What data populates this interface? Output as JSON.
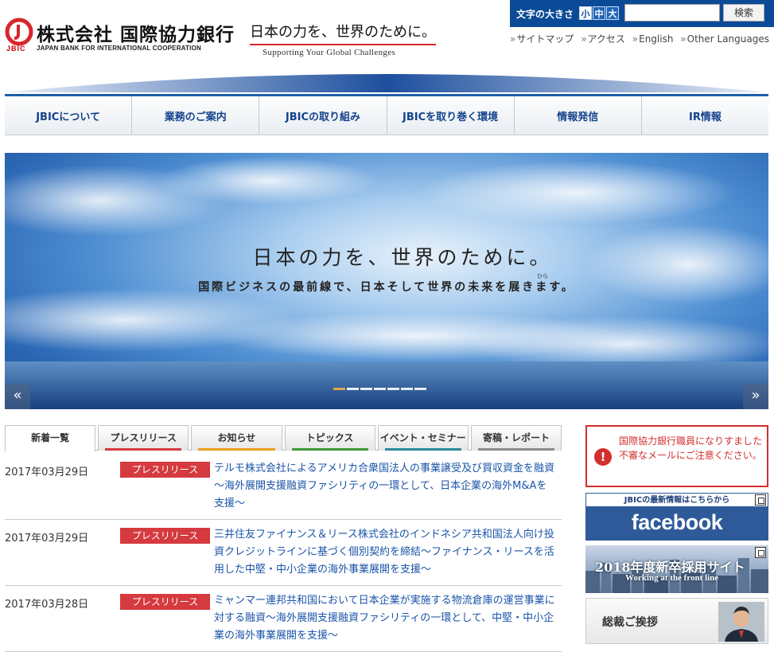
{
  "header": {
    "logo_jbic": "JBIC",
    "logo_name_ja": "株式会社 国際協力銀行",
    "logo_name_en": "JAPAN BANK FOR INTERNATIONAL COOPERATION",
    "tagline_ja": "日本の力を、世界のために。",
    "tagline_en": "Supporting Your Global Challenges",
    "fontsize_label": "文字の大きさ",
    "fontsize_small": "小",
    "fontsize_mid": "中",
    "fontsize_large": "大",
    "search_value": "",
    "search_button": "検索",
    "links": [
      "サイトマップ",
      "アクセス",
      "English",
      "Other Languages"
    ]
  },
  "nav": [
    "JBICについて",
    "業務のご案内",
    "JBICの取り組み",
    "JBICを取り巻く環境",
    "情報発信",
    "IR情報"
  ],
  "hero": {
    "title": "日本の力を、世界のために。",
    "subtitle": "国際ビジネスの最前線で、日本そして世界の未来を展きます。",
    "ruby": "ひら",
    "prev": "«",
    "next": "»",
    "slide_count": 7,
    "active_slide": 0
  },
  "tabs": [
    {
      "label": "新着一覧",
      "active": true,
      "bar": "#ffffff"
    },
    {
      "label": "プレスリリース",
      "active": false,
      "bar": "#d53a3f"
    },
    {
      "label": "お知らせ",
      "active": false,
      "bar": "#e6a11f"
    },
    {
      "label": "トピックス",
      "active": false,
      "bar": "#3f9a3a"
    },
    {
      "label": "イベント・セミナー",
      "active": false,
      "bar": "#2a8a9a"
    },
    {
      "label": "寄稿・レポート",
      "active": false,
      "bar": "#8a8a8a"
    }
  ],
  "news": [
    {
      "date": "2017年03月29日",
      "category": "プレスリリース",
      "title": "テルモ株式会社によるアメリカ合衆国法人の事業譲受及び買収資金を融資～海外展開支援融資ファシリティの一環として、日本企業の海外M&Aを支援～"
    },
    {
      "date": "2017年03月29日",
      "category": "プレスリリース",
      "title": "三井住友ファイナンス＆リース株式会社のインドネシア共和国法人向け投資クレジットラインに基づく個別契約を締結～ファイナンス・リースを活用した中堅・中小企業の海外事業展開を支援～"
    },
    {
      "date": "2017年03月28日",
      "category": "プレスリリース",
      "title": "ミャンマー連邦共和国において日本企業が実施する物流倉庫の運営事業に対する融資～海外展開支援融資ファシリティの一環として、中堅・中小企業の海外事業展開を支援～"
    }
  ],
  "sidebar": {
    "alert_icon": "!",
    "alert_text": "国際協力銀行職員になりすました不審なメールにご注意ください。",
    "fb_top": "JBICの最新情報はこちらから",
    "fb_logo": "facebook",
    "recruit_title": "2018年度新卒採用サイト",
    "recruit_sub": "Working at the front line",
    "greeting_label": "総裁ご挨拶"
  },
  "colors": {
    "brand_blue": "#0b4a96",
    "nav_text": "#14438c",
    "press_badge": "#d53a3f",
    "alert_red": "#d32f2f",
    "link_blue": "#1a54a8"
  }
}
